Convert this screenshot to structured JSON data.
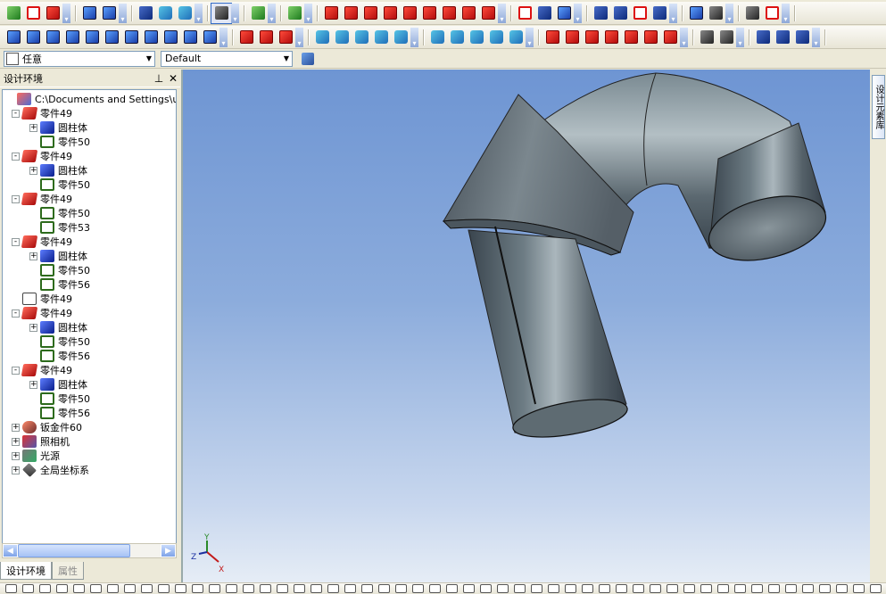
{
  "colors": {
    "viewport_top": "#6e95d3",
    "viewport_bottom": "#e6edf6",
    "model_dark": "#36404a",
    "model_light": "#aab6bc"
  },
  "toolbar1": {
    "groups": [
      [
        "new-file-icon",
        "open-folder-icon",
        "save-icon"
      ],
      [
        "undo-icon",
        "redo-icon"
      ],
      [
        "copy-icon",
        "paste-icon",
        "print-icon"
      ],
      [
        "preview-icon"
      ],
      [
        "green-arrow-icon"
      ],
      [
        "help-cursor-icon"
      ],
      [
        "red-cube-1-icon",
        "red-cube-2-icon",
        "red-cube-3-icon",
        "red-cube-4-icon",
        "red-cube-5-icon",
        "red-cube-6-icon",
        "red-cube-7-icon",
        "red-cube-8-icon",
        "red-cube-9-icon"
      ],
      [
        "gear-icon",
        "measure-icon",
        "render-icon"
      ],
      [
        "export-icon",
        "rotate-icon",
        "arc-icon",
        "smooth-icon"
      ],
      [
        "text-icon",
        "dimension-icon"
      ],
      [
        "box-view-icon",
        "wire-view-icon"
      ]
    ]
  },
  "toolbar2": {
    "groups": [
      [
        "curve-1-icon",
        "curve-2-icon",
        "curve-3-icon",
        "curve-4-icon",
        "curve-5-icon",
        "curve-6-icon",
        "curve-7-icon",
        "curve-8-icon",
        "curve-9-icon",
        "curve-10-icon",
        "curve-11-icon"
      ],
      [
        "solid-1-icon",
        "solid-2-icon",
        "solid-3-icon"
      ],
      [
        "feature-1-icon",
        "feature-2-icon",
        "feature-3-icon",
        "feature-4-icon",
        "feature-5-icon"
      ],
      [
        "surface-1-icon",
        "surface-2-icon",
        "surface-3-icon",
        "surface-4-icon",
        "surface-5-icon"
      ],
      [
        "sheet-1-icon",
        "sheet-2-icon",
        "sheet-3-icon",
        "sheet-4-icon",
        "sheet-5-icon",
        "sheet-6-icon",
        "sheet-7-icon"
      ],
      [
        "pick-1-icon",
        "pick-2-icon"
      ],
      [
        "hammer-1-icon",
        "hammer-2-icon",
        "hammer-3-icon"
      ]
    ]
  },
  "toolbar3": {
    "selection_filter": "任意",
    "style": "Default"
  },
  "design_panel": {
    "title": "设计环境",
    "pin_icon": "pin-icon",
    "close_icon": "close-icon",
    "tabs": [
      {
        "label": "设计环境",
        "active": true
      },
      {
        "label": "属性",
        "active": false
      }
    ]
  },
  "tree": {
    "rows": [
      {
        "label": "C:\\Documents and Settings\\user\\桌",
        "level": 0,
        "expander": "none",
        "icon": "root"
      },
      {
        "label": "零件49",
        "level": 1,
        "expander": "-",
        "icon": "assembly"
      },
      {
        "label": "圆柱体",
        "level": 2,
        "expander": "+",
        "icon": "cyl"
      },
      {
        "label": "零件50",
        "level": 2,
        "expander": "none",
        "icon": "part"
      },
      {
        "label": "零件49",
        "level": 1,
        "expander": "-",
        "icon": "assembly"
      },
      {
        "label": "圆柱体",
        "level": 2,
        "expander": "+",
        "icon": "cyl"
      },
      {
        "label": "零件50",
        "level": 2,
        "expander": "none",
        "icon": "part"
      },
      {
        "label": "零件49",
        "level": 1,
        "expander": "-",
        "icon": "assembly"
      },
      {
        "label": "零件50",
        "level": 2,
        "expander": "none",
        "icon": "part"
      },
      {
        "label": "零件53",
        "level": 2,
        "expander": "none",
        "icon": "part"
      },
      {
        "label": "零件49",
        "level": 1,
        "expander": "-",
        "icon": "assembly"
      },
      {
        "label": "圆柱体",
        "level": 2,
        "expander": "+",
        "icon": "cyl"
      },
      {
        "label": "零件50",
        "level": 2,
        "expander": "none",
        "icon": "part"
      },
      {
        "label": "零件56",
        "level": 2,
        "expander": "none",
        "icon": "part"
      },
      {
        "label": "零件49",
        "level": 1,
        "expander": "none",
        "icon": "ghost"
      },
      {
        "label": "零件49",
        "level": 1,
        "expander": "-",
        "icon": "assembly"
      },
      {
        "label": "圆柱体",
        "level": 2,
        "expander": "+",
        "icon": "cyl"
      },
      {
        "label": "零件50",
        "level": 2,
        "expander": "none",
        "icon": "part"
      },
      {
        "label": "零件56",
        "level": 2,
        "expander": "none",
        "icon": "part"
      },
      {
        "label": "零件49",
        "level": 1,
        "expander": "-",
        "icon": "assembly"
      },
      {
        "label": "圆柱体",
        "level": 2,
        "expander": "+",
        "icon": "cyl"
      },
      {
        "label": "零件50",
        "level": 2,
        "expander": "none",
        "icon": "part"
      },
      {
        "label": "零件56",
        "level": 2,
        "expander": "none",
        "icon": "part"
      },
      {
        "label": "钣金件60",
        "level": 1,
        "expander": "+",
        "icon": "sheet"
      },
      {
        "label": "照相机",
        "level": 1,
        "expander": "+",
        "icon": "camera"
      },
      {
        "label": "光源",
        "level": 1,
        "expander": "+",
        "icon": "light"
      },
      {
        "label": "全局坐标系",
        "level": 1,
        "expander": "+",
        "icon": "coord"
      }
    ]
  },
  "side_panel": {
    "tab_label": "设计元素库"
  },
  "axis_triad": {
    "x": "X",
    "y": "Y",
    "z": "Z"
  }
}
